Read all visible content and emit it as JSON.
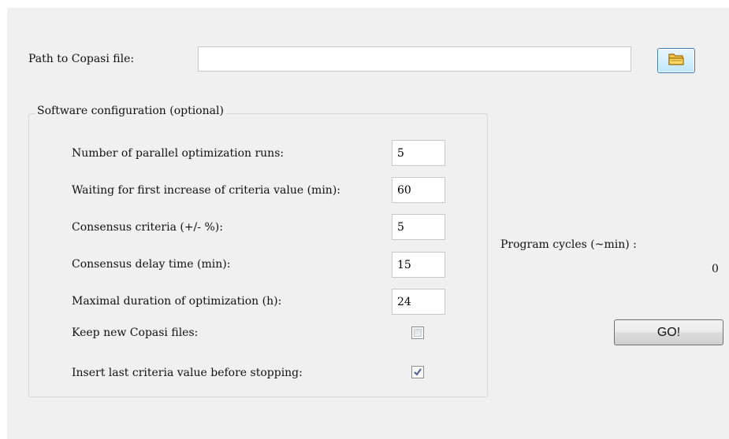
{
  "path_label": "Path to Copasi file:",
  "path_value": "",
  "browse_icon": "folder-icon",
  "group_title": "Software configuration (optional)",
  "fields": {
    "parallel_runs": {
      "label": "Number of parallel optimization runs:",
      "value": "5"
    },
    "waiting_first_increase": {
      "label": "Waiting for first increase of criteria value (min):",
      "value": "60"
    },
    "consensus_criteria": {
      "label": "Consensus criteria (+/- %):",
      "value": "5"
    },
    "consensus_delay": {
      "label": "Consensus delay time (min):",
      "value": "15"
    },
    "max_duration": {
      "label": "Maximal duration of optimization (h):",
      "value": "24"
    }
  },
  "checkboxes": {
    "keep_files": {
      "label": "Keep new Copasi files:",
      "checked": false
    },
    "insert_last": {
      "label": "Insert last criteria value before stopping:",
      "checked": true
    }
  },
  "program_cycles_label": "Program cycles (~min) :",
  "program_cycles_value": "0",
  "go_label": "GO!",
  "colors": {
    "window_bg": "#f0f0f0",
    "accent_border": "#3c7fb1",
    "check_mark": "#4a5f97"
  }
}
